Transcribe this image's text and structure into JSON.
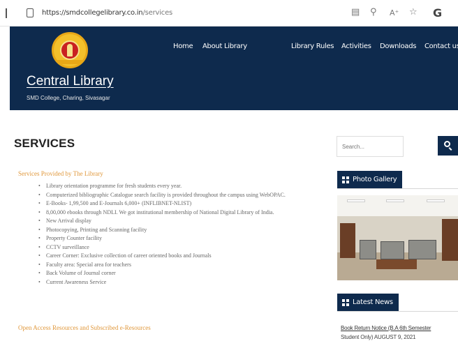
{
  "browser": {
    "url_host": "https://smdcollegelibrary.co.in",
    "url_path": "/services",
    "icons": [
      "lock-icon",
      "reader-view-icon",
      "zoom-icon",
      "read-aloud-icon",
      "favorite-icon",
      "profile-icon"
    ],
    "profile_letter": "G"
  },
  "header": {
    "site_title": "Central Library",
    "site_subtitle": "SMD College, Charing, Sivasagar",
    "nav": [
      "Home",
      "About Library",
      "Library Rules",
      "Activities",
      "Downloads",
      "Contact us"
    ]
  },
  "main": {
    "page_title": "SERVICES",
    "section_heading": "Services Provided by The Library",
    "services": [
      "Library orientation programme for fresh students every year.",
      "Computerized bibliographic Catalogue search facility is provided throughout the campus using WebOPAC.",
      "E-Books- 1,99,500 and E-Journals 6,000+ (INFLIBNET-NLIST)",
      "8,00,000 ebooks through NDLI. We got institutional membership of National Digital Library of India.",
      "New Arrival display",
      "Photocopying, Printing and Scanning facility",
      "Property Counter facility",
      "CCTV surveillance",
      "Career Corner: Exclusive collection of career oriented books and Journals",
      "Faculty area: Special area for teachers",
      "Back Volume of Journal corner",
      "Current Awareness Service"
    ],
    "section_heading_2": "Open Access Resources and Subscribed e-Resources"
  },
  "sidebar": {
    "search_placeholder": "Search...",
    "photo_gallery_title": "Photo Gallery",
    "latest_news_title": "Latest News",
    "news": [
      {
        "title": "Book Return Notice (B.A 6th Semester",
        "date": "Student Only) AUGUST 9, 2021"
      }
    ]
  },
  "colors": {
    "header_bg": "#0e2a4d",
    "accent_orange": "#e0983c"
  }
}
